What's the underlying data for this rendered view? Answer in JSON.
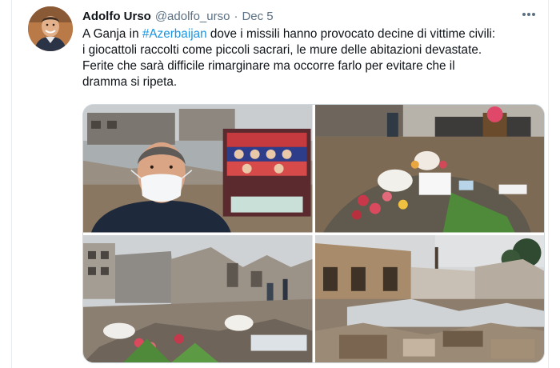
{
  "tweet": {
    "author": {
      "display_name": "Adolfo Urso",
      "handle": "@adolfo_urso"
    },
    "separator": "·",
    "date": "Dec 5",
    "text": {
      "line1_prefix": "A Ganja in ",
      "hashtag": "#Azerbaijan",
      "line1_suffix": " dove i missili hanno provocato decine di vittime civili:",
      "line2": "i giocattoli raccolti come piccoli sacrari, le mure delle abitazioni devastate.",
      "line3": "Ferite che sarà difficile rimarginare ma occorre farlo per evitare che il",
      "line4": "dramma si ripeta."
    },
    "media": [
      {
        "id": "photo-1",
        "icon": "selfie-memorial-photo"
      },
      {
        "id": "photo-2",
        "icon": "toys-memorial-photo"
      },
      {
        "id": "photo-3",
        "icon": "ruins-photo"
      },
      {
        "id": "photo-4",
        "icon": "destroyed-house-photo"
      }
    ],
    "more_icon": "more-horizontal-icon"
  },
  "colors": {
    "accent": "#1b95e0",
    "text": "#0f1419",
    "secondary": "#5b7083",
    "border": "#cfd9de"
  }
}
